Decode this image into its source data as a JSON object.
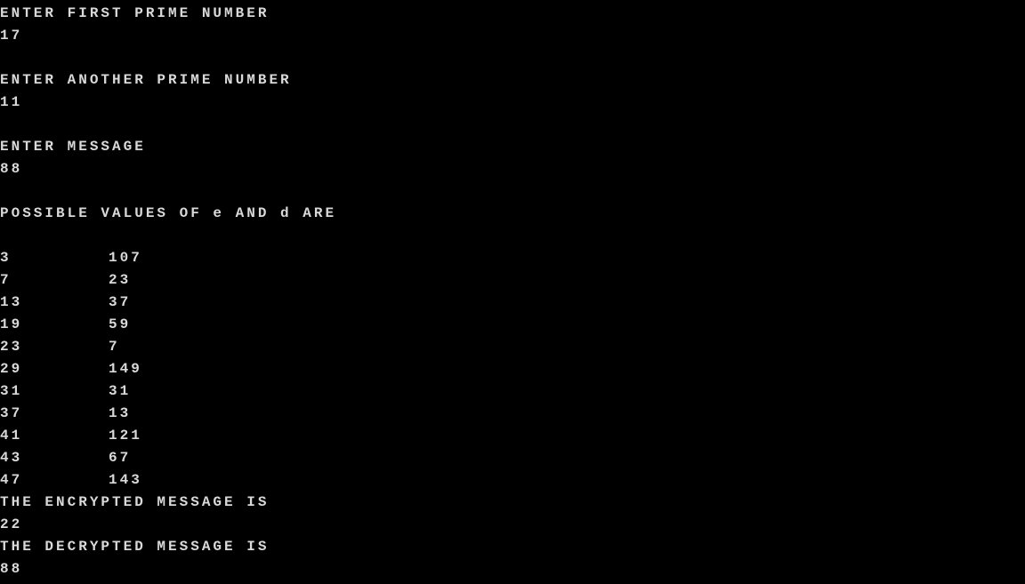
{
  "console": {
    "prompt_p": "ENTER FIRST PRIME NUMBER",
    "value_p": "17",
    "prompt_q": "ENTER ANOTHER PRIME NUMBER",
    "value_q": "11",
    "prompt_msg": "ENTER MESSAGE",
    "value_msg": "88",
    "values_header": "POSSIBLE VALUES OF e AND d ARE",
    "pairs": [
      {
        "e": "3",
        "d": "107"
      },
      {
        "e": "7",
        "d": "23"
      },
      {
        "e": "13",
        "d": "37"
      },
      {
        "e": "19",
        "d": "59"
      },
      {
        "e": "23",
        "d": "7"
      },
      {
        "e": "29",
        "d": "149"
      },
      {
        "e": "31",
        "d": "31"
      },
      {
        "e": "37",
        "d": "13"
      },
      {
        "e": "41",
        "d": "121"
      },
      {
        "e": "43",
        "d": "67"
      },
      {
        "e": "47",
        "d": "143"
      }
    ],
    "encrypted_label": "THE ENCRYPTED MESSAGE IS",
    "encrypted_value": "22",
    "decrypted_label": "THE DECRYPTED MESSAGE IS",
    "decrypted_value": "88"
  },
  "colors": {
    "background": "#000000",
    "text": "#d9d9d9"
  }
}
